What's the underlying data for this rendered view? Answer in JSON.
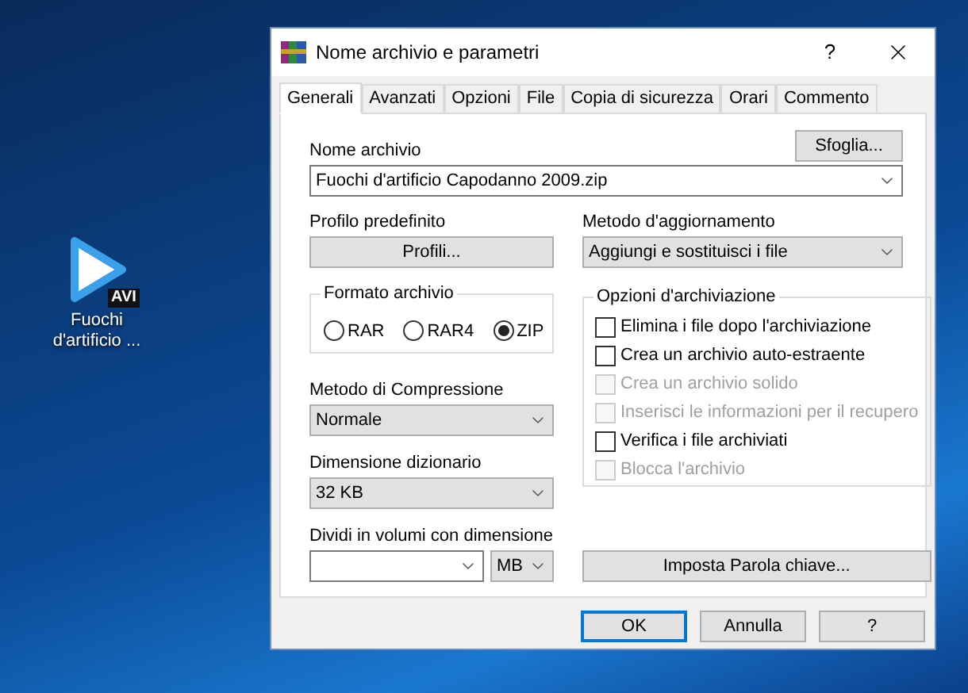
{
  "desktop_icon": {
    "badge": "AVI",
    "label": "Fuochi d'artificio ..."
  },
  "window": {
    "title": "Nome archivio e parametri",
    "help": "?"
  },
  "tabs": [
    {
      "label": "Generali",
      "selected": true
    },
    {
      "label": "Avanzati",
      "selected": false
    },
    {
      "label": "Opzioni",
      "selected": false
    },
    {
      "label": "File",
      "selected": false
    },
    {
      "label": "Copia di sicurezza",
      "selected": false
    },
    {
      "label": "Orari",
      "selected": false
    },
    {
      "label": "Commento",
      "selected": false
    }
  ],
  "archive_name": {
    "label": "Nome archivio",
    "browse": "Sfoglia...",
    "value": "Fuochi d'artificio Capodanno 2009.zip"
  },
  "profile": {
    "label": "Profilo predefinito",
    "button": "Profili..."
  },
  "update_method": {
    "label": "Metodo d'aggiornamento",
    "value": "Aggiungi e sostituisci i file"
  },
  "archive_format": {
    "label": "Formato archivio",
    "options": [
      {
        "label": "RAR",
        "selected": false
      },
      {
        "label": "RAR4",
        "selected": false
      },
      {
        "label": "ZIP",
        "selected": true
      }
    ]
  },
  "compression": {
    "label": "Metodo di Compressione",
    "value": "Normale"
  },
  "dictionary": {
    "label": "Dimensione dizionario",
    "value": "32 KB"
  },
  "split": {
    "label": "Dividi in volumi con dimensione",
    "unit": "MB"
  },
  "archiving_options": {
    "label": "Opzioni d'archiviazione",
    "items": [
      {
        "label": "Elimina i file dopo l'archiviazione",
        "checked": false,
        "disabled": false
      },
      {
        "label": "Crea un archivio auto-estraente",
        "checked": false,
        "disabled": false
      },
      {
        "label": "Crea un archivio solido",
        "checked": false,
        "disabled": true
      },
      {
        "label": "Inserisci le informazioni per il recupero",
        "checked": false,
        "disabled": true
      },
      {
        "label": "Verifica i file archiviati",
        "checked": false,
        "disabled": false
      },
      {
        "label": "Blocca l'archivio",
        "checked": false,
        "disabled": true
      }
    ]
  },
  "password_button": "Imposta Parola chiave...",
  "buttons": [
    {
      "label": "OK",
      "focused": true
    },
    {
      "label": "Annulla",
      "focused": false
    },
    {
      "label": "?",
      "focused": false
    }
  ]
}
